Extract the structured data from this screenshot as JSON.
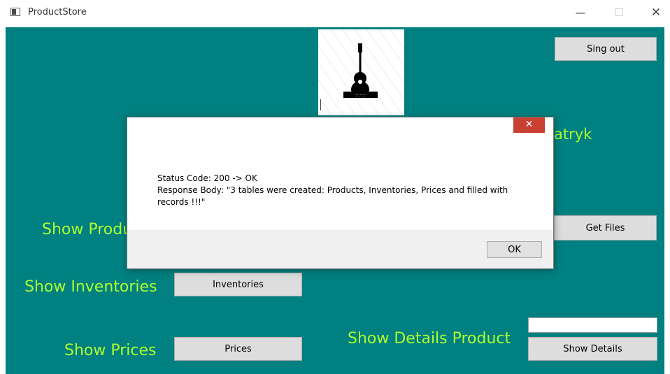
{
  "window": {
    "title": "ProductStore",
    "minimize": "—",
    "maximize": "☐",
    "close": "✕"
  },
  "main": {
    "sign_out_label": "Sing out",
    "welcome_partial": "atryk",
    "show_products_label": "Show Produ",
    "get_files_label": "Get Files",
    "show_inventories_label": "Show Inventories",
    "inventories_button": "Inventories",
    "show_prices_label": "Show Prices",
    "prices_button": "Prices",
    "show_details_product_label": "Show Details Product",
    "show_details_button": "Show Details",
    "details_input_value": ""
  },
  "dialog": {
    "close": "✕",
    "status_line": "Status Code: 200 -> OK",
    "body_line": "Response Body: \"3 tables were created: Products, Inventories, Prices and filled with records !!!\"",
    "ok_label": "OK"
  },
  "colors": {
    "background": "#008080",
    "label": "#adff2f",
    "dialog_close": "#c84031"
  },
  "icons": {
    "logo": "guitar-logo-icon"
  }
}
